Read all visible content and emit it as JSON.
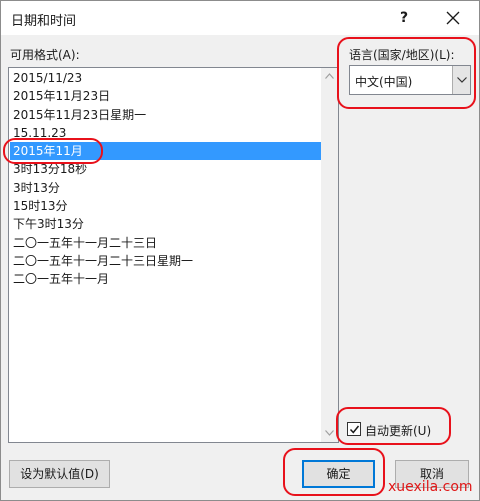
{
  "dialog": {
    "title": "日期和时间",
    "help_glyph": "?"
  },
  "formats": {
    "label": "可用格式(A):",
    "items": [
      "2015/11/23",
      "2015年11月23日",
      "2015年11月23日星期一",
      "15.11.23",
      "2015年11月",
      "3时13分18秒",
      "3时13分",
      "15时13分",
      "下午3时13分",
      "二〇一五年十一月二十三日",
      "二〇一五年十一月二十三日星期一",
      "二〇一五年十一月"
    ],
    "selected_index": 4
  },
  "language": {
    "label": "语言(国家/地区)(L):",
    "value": "中文(中国)"
  },
  "auto_update": {
    "label": "自动更新(U)",
    "checked": true
  },
  "buttons": {
    "set_default": "设为默认值(D)",
    "ok": "确定",
    "cancel": "取消"
  },
  "watermark": "xuexila.com",
  "colors": {
    "selection": "#3399ff",
    "annotation": "#e8111b",
    "watermark": "#e01717"
  }
}
